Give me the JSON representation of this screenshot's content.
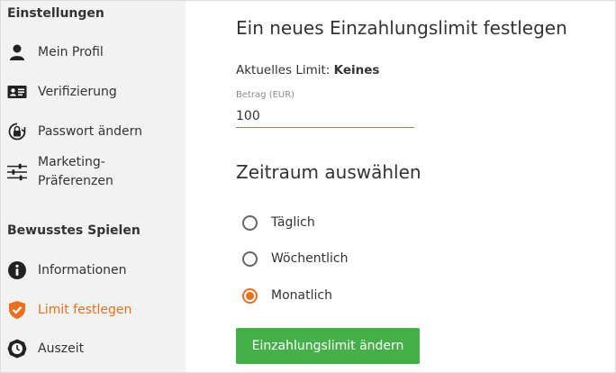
{
  "sidebar": {
    "section1_title": "Einstellungen",
    "section2_title": "Bewusstes Spielen",
    "items": [
      {
        "label": "Mein Profil",
        "icon": "user-icon"
      },
      {
        "label": "Verifizierung",
        "icon": "id-card-icon"
      },
      {
        "label": "Passwort ändern",
        "icon": "lock-icon"
      },
      {
        "label": "Marketing-\nPräferenzen",
        "icon": "sliders-icon"
      },
      {
        "label": "Informationen",
        "icon": "info-icon"
      },
      {
        "label": "Limit festlegen",
        "icon": "shield-check-icon",
        "active": true
      },
      {
        "label": "Auszeit",
        "icon": "clock-icon"
      }
    ]
  },
  "main": {
    "title": "Ein neues Einzahlungslimit festlegen",
    "current_limit_label": "Aktuelles Limit:",
    "current_limit_value": "Keines",
    "amount_label": "Betrag (EUR)",
    "amount_value": "100",
    "period_title": "Zeitraum auswählen",
    "periods": [
      {
        "label": "Täglich",
        "checked": false
      },
      {
        "label": "Wöchentlich",
        "checked": false
      },
      {
        "label": "Monatlich",
        "checked": true
      }
    ],
    "submit_label": "Einzahlungslimit ändern"
  },
  "colors": {
    "accent": "#e8701e",
    "button": "#45b04a",
    "input_underline": "#4caf50",
    "sidebar_bg": "#f2f2f2"
  }
}
